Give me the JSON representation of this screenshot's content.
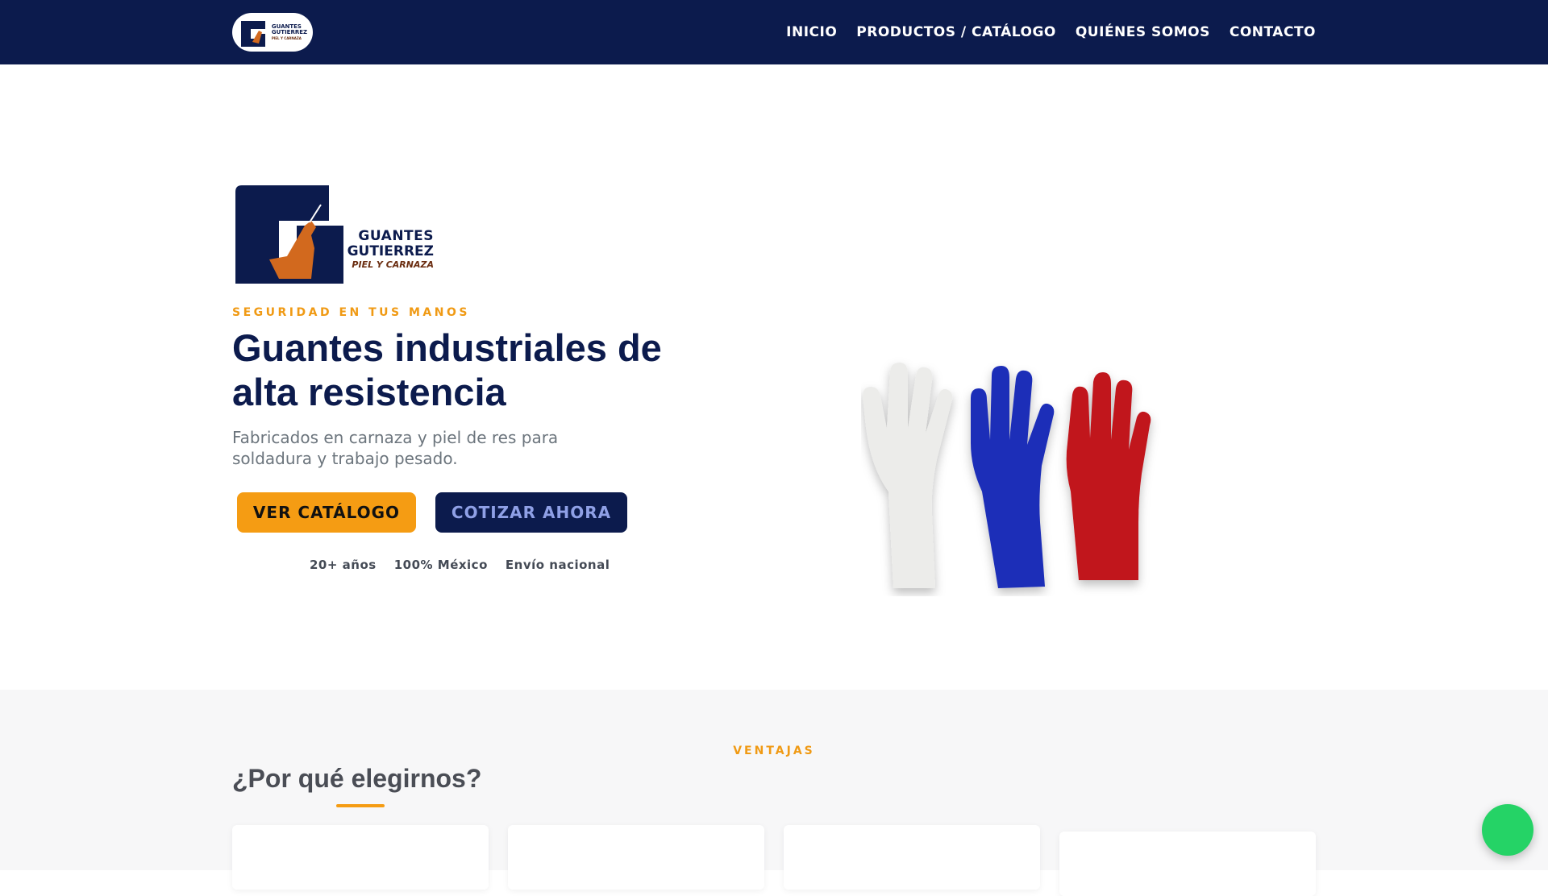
{
  "brand": {
    "name_line1": "GUANTES",
    "name_line2": "GUTIERREZ",
    "name_line3": "PIEL Y CARNAZA",
    "colors": {
      "navy": "#0c1b4d",
      "accent": "#f59c13",
      "whatsapp": "#25d366"
    }
  },
  "nav": {
    "items": [
      {
        "label": "INICIO"
      },
      {
        "label": "PRODUCTOS / CATÁLOGO"
      },
      {
        "label": "QUIÉNES SOMOS"
      },
      {
        "label": "CONTACTO"
      }
    ]
  },
  "hero": {
    "tagline": "SEGURIDAD EN TUS MANOS",
    "title": "Guantes industriales de alta resistencia",
    "subtitle": "Fabricados en carnaza y piel de res para soldadura y trabajo pesado.",
    "primary_button": "VER CATÁLOGO",
    "secondary_button": "COTIZAR AHORA",
    "stats": [
      "20+ años",
      "100% México",
      "Envío nacional"
    ]
  },
  "ventajas": {
    "tag": "VENTAJAS",
    "title": "¿Por qué elegirnos?"
  },
  "icons": {
    "whatsapp": "whatsapp-icon"
  }
}
